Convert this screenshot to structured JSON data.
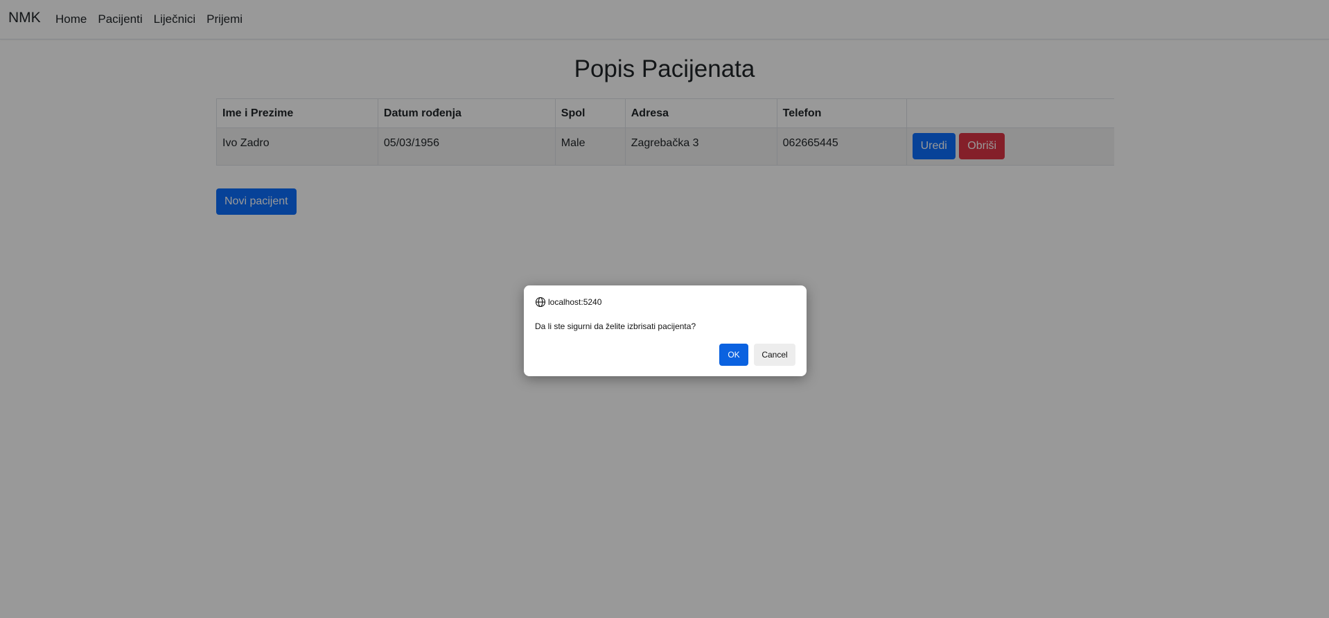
{
  "navbar": {
    "brand": "NMK",
    "links": [
      "Home",
      "Pacijenti",
      "Liječnici",
      "Prijemi"
    ]
  },
  "page": {
    "title": "Popis Pacijenata"
  },
  "table": {
    "headers": [
      "Ime i Prezime",
      "Datum rođenja",
      "Spol",
      "Adresa",
      "Telefon",
      ""
    ],
    "rows": [
      {
        "name": "Ivo Zadro",
        "dob": "05/03/1956",
        "gender": "Male",
        "address": "Zagrebačka 3",
        "phone": "062665445",
        "edit_label": "Uredi",
        "delete_label": "Obriši"
      }
    ]
  },
  "new_patient_label": "Novi pacijent",
  "dialog": {
    "origin": "localhost:5240",
    "message": "Da li ste sigurni da želite izbrisati pacijenta?",
    "ok_label": "OK",
    "cancel_label": "Cancel"
  },
  "colors": {
    "primary": "#0d6efd",
    "danger": "#dc3545",
    "dialog_ok": "#0b62e0"
  },
  "icons": {
    "dialog_origin": "globe-icon"
  }
}
